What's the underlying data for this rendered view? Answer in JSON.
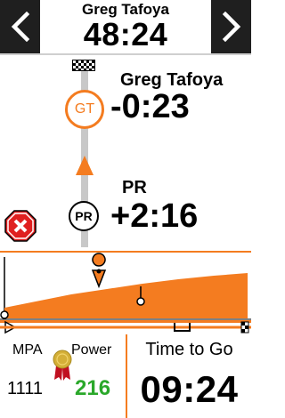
{
  "header": {
    "rival_name": "Greg Tafoya",
    "elapsed_time": "48:24",
    "prev_icon": "chevron-left-icon",
    "next_icon": "chevron-right-icon"
  },
  "segment": {
    "finish_icon": "checkered-flag-icon",
    "rival": {
      "badge": "GT",
      "name": "Greg Tafoya",
      "gap": "-0:23"
    },
    "personal_record": {
      "badge": "PR",
      "label": "PR",
      "gap": "+2:16"
    },
    "you_icon": "position-arrow-icon",
    "stop_icon": "stop-x-icon"
  },
  "fields": {
    "mpa_label": "MPA",
    "power_label": "Power",
    "mpa_value": "1111",
    "power_value": "216",
    "time_to_go_label": "Time to Go",
    "time_to_go_value": "09:24",
    "medal_icon": "medal-icon"
  },
  "colors": {
    "accent": "#f47c20",
    "power": "#2aa82a",
    "stop": "#e02020",
    "nav_bg": "#1f1f1f"
  }
}
